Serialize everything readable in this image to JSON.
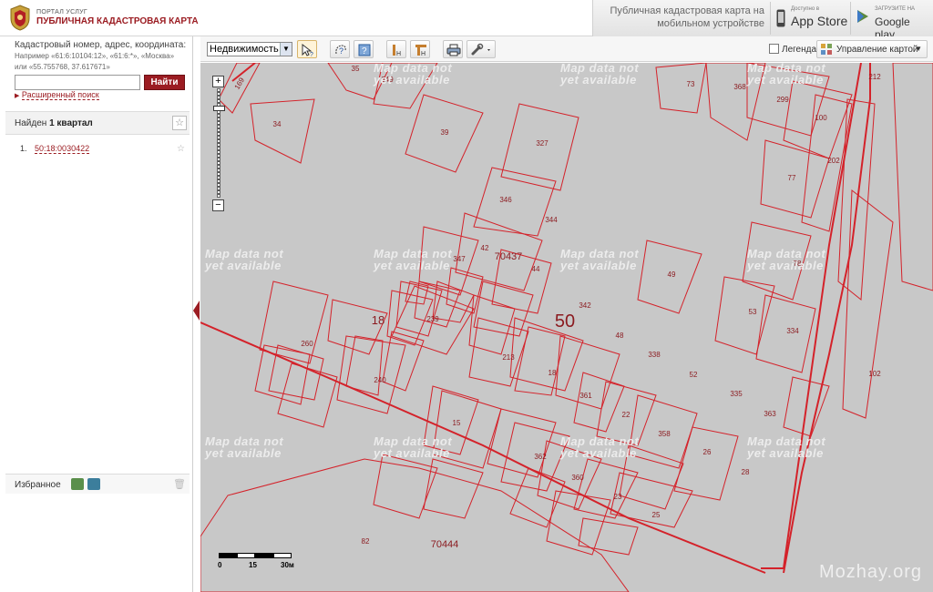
{
  "header": {
    "portal_small": "ПОРТАЛ УСЛУГ",
    "portal_title": "ПУБЛИЧНАЯ КАДАСТРОВАЯ КАРТА",
    "promo_text": "Публичная кадастровая карта на мобильном устройстве",
    "appstore_small": "Доступно в",
    "appstore_name": "App Store",
    "google_small": "ЗАГРУЗИТЕ НА",
    "google_name": "Google play"
  },
  "sidebar": {
    "search_hint": "Кадастровый номер, адрес, координата:",
    "search_examples": "Например «61:6:10104:12», «61:6:*», «Москва» или «55.755768, 37.617671»",
    "search_value": "",
    "search_button": "Найти",
    "advanced_link": "Расширенный поиск",
    "found_prefix": "Найден",
    "found_bold": "1 квартал",
    "results": [
      {
        "index": "1.",
        "number": "50:18:0030422"
      }
    ],
    "favorites_label": "Избранное"
  },
  "toolbar": {
    "layer_select": "Недвижимость",
    "legend_label": "Легенда",
    "map_control_label": "Управление картой"
  },
  "map": {
    "watermark_line1": "Map data not",
    "watermark_line2": "yet available",
    "scale_labels": [
      "0",
      "15",
      "30м"
    ],
    "site_watermark": "Mozhay.org",
    "labels": [
      "35",
      "349",
      "73",
      "368",
      "299",
      "212",
      "34",
      "39",
      "327",
      "100",
      "202",
      "77",
      "346",
      "344",
      "347",
      "42",
      "70437",
      "44",
      "49",
      "78",
      "342",
      "18",
      "239",
      "50",
      "53",
      "48",
      "338",
      "334",
      "260",
      "213",
      "18",
      "52",
      "102",
      "240",
      "361",
      "335",
      "22",
      "15",
      "363",
      "358",
      "26",
      "362",
      "28",
      "360",
      "23",
      "25",
      "82",
      "70444",
      "169"
    ],
    "colors": {
      "parcel_line": "#d4222a",
      "map_bg": "#c8c8c8",
      "accent": "#9b1c22"
    }
  }
}
